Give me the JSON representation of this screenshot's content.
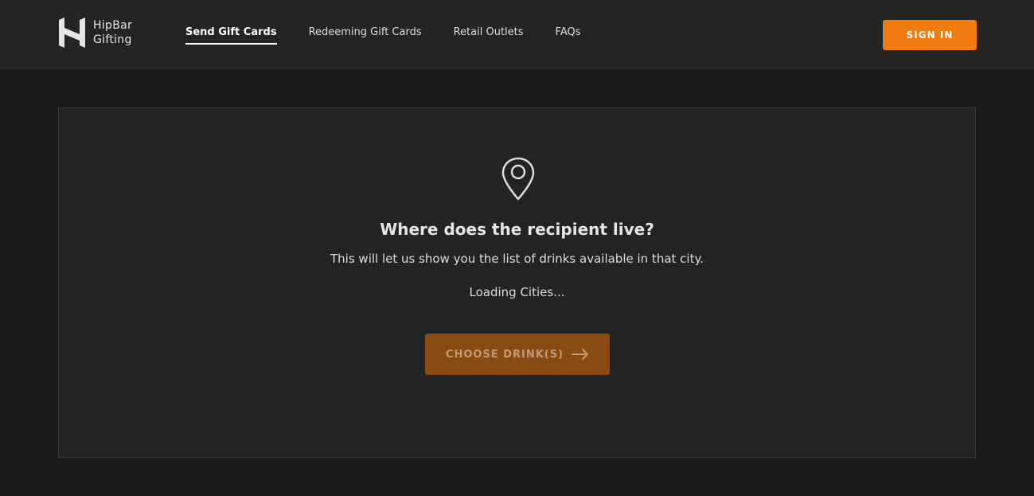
{
  "header": {
    "logo": {
      "line1": "HipBar",
      "line2": "Gifting"
    },
    "nav": [
      {
        "label": "Send Gift Cards",
        "active": true
      },
      {
        "label": "Redeeming Gift Cards",
        "active": false
      },
      {
        "label": "Retail Outlets",
        "active": false
      },
      {
        "label": "FAQs",
        "active": false
      }
    ],
    "signin_label": "SIGN IN"
  },
  "main": {
    "icon": "location-pin-icon",
    "question": "Where does the recipient live?",
    "subtitle": "This will let us show you the list of drinks available in that city.",
    "loading": "Loading Cities...",
    "cta_label": "CHOOSE DRINK(S)",
    "cta_icon": "arrow-right-icon"
  },
  "colors": {
    "accent": "#f07c0f",
    "cta_disabled": "#8a4b12",
    "background": "#1a1a1a",
    "header_bg": "#242424",
    "card_bg": "#232323"
  }
}
